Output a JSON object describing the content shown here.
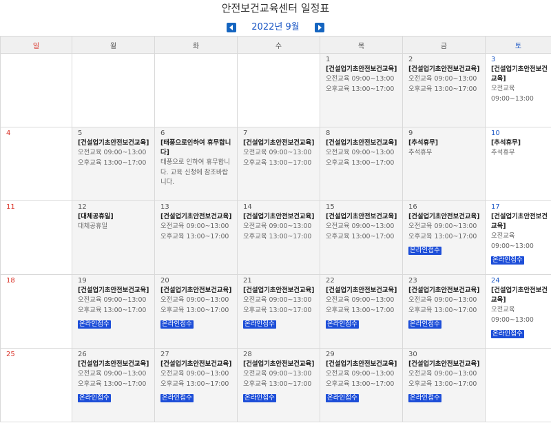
{
  "page": {
    "title": "안전보건교육센터 일정표",
    "month_label": "2022년 9월",
    "accent_color": "#1565c0",
    "sunday_color": "#d93025",
    "saturday_color": "#1a56c4"
  },
  "weekdays": [
    {
      "label": "일",
      "kind": "sun"
    },
    {
      "label": "월",
      "kind": ""
    },
    {
      "label": "화",
      "kind": ""
    },
    {
      "label": "수",
      "kind": ""
    },
    {
      "label": "목",
      "kind": ""
    },
    {
      "label": "금",
      "kind": ""
    },
    {
      "label": "토",
      "kind": "sat"
    }
  ],
  "weeks": [
    [
      null,
      null,
      null,
      null,
      {
        "day": "1",
        "title": "[건설업기초안전보건교육]",
        "lines": [
          "오전교육 09:00~13:00",
          "오후교육 13:00~17:00"
        ]
      },
      {
        "day": "2",
        "title": "[건설업기초안전보건교육]",
        "lines": [
          "오전교육 09:00~13:00",
          "오후교육 13:00~17:00"
        ]
      },
      {
        "day": "3",
        "title": "[건설업기초안전보건교육]",
        "lines": [
          "오전교육",
          "09:00~13:00"
        ]
      }
    ],
    [
      {
        "day": "4"
      },
      {
        "day": "5",
        "title": "[건설업기초안전보건교육]",
        "lines": [
          "오전교육 09:00~13:00",
          "오후교육 13:00~17:00"
        ]
      },
      {
        "day": "6",
        "title": "[태풍으로인하여 휴무합니다]",
        "lines": [
          "태풍으로 인하여 휴무합니다. 교육 신청에 참조바랍니다."
        ],
        "wrap": true
      },
      {
        "day": "7",
        "title": "[건설업기초안전보건교육]",
        "lines": [
          "오전교육 09:00~13:00",
          "오후교육 13:00~17:00"
        ]
      },
      {
        "day": "8",
        "title": "[건설업기초안전보건교육]",
        "lines": [
          "오전교육 09:00~13:00",
          "오후교육 13:00~17:00"
        ]
      },
      {
        "day": "9",
        "title": "[추석휴무]",
        "lines": [
          "추석휴무"
        ]
      },
      {
        "day": "10",
        "title": "[추석휴무]",
        "lines": [
          "추석휴무"
        ]
      }
    ],
    [
      {
        "day": "11"
      },
      {
        "day": "12",
        "title": "[대체공휴일]",
        "lines": [
          "대체공휴일"
        ]
      },
      {
        "day": "13",
        "title": "[건설업기초안전보건교육]",
        "lines": [
          "오전교육 09:00~13:00",
          "오후교육 13:00~17:00"
        ]
      },
      {
        "day": "14",
        "title": "[건설업기초안전보건교육]",
        "lines": [
          "오전교육 09:00~13:00",
          "오후교육 13:00~17:00"
        ]
      },
      {
        "day": "15",
        "title": "[건설업기초안전보건교육]",
        "lines": [
          "오전교육 09:00~13:00",
          "오후교육 13:00~17:00"
        ]
      },
      {
        "day": "16",
        "title": "[건설업기초안전보건교육]",
        "lines": [
          "오전교육 09:00~13:00",
          "오후교육 13:00~17:00"
        ],
        "badge": "온라인접수"
      },
      {
        "day": "17",
        "title": "[건설업기초안전보건교육]",
        "lines": [
          "오전교육",
          "09:00~13:00"
        ],
        "badge": "온라인접수"
      }
    ],
    [
      {
        "day": "18"
      },
      {
        "day": "19",
        "title": "[건설업기초안전보건교육]",
        "lines": [
          "오전교육 09:00~13:00",
          "오후교육 13:00~17:00"
        ],
        "badge": "온라인접수"
      },
      {
        "day": "20",
        "title": "[건설업기초안전보건교육]",
        "lines": [
          "오전교육 09:00~13:00",
          "오후교육 13:00~17:00"
        ],
        "badge": "온라인접수"
      },
      {
        "day": "21",
        "title": "[건설업기초안전보건교육]",
        "lines": [
          "오전교육 09:00~13:00",
          "오후교육 13:00~17:00"
        ],
        "badge": "온라인접수"
      },
      {
        "day": "22",
        "title": "[건설업기초안전보건교육]",
        "lines": [
          "오전교육 09:00~13:00",
          "오후교육 13:00~17:00"
        ],
        "badge": "온라인접수"
      },
      {
        "day": "23",
        "title": "[건설업기초안전보건교육]",
        "lines": [
          "오전교육 09:00~13:00",
          "오후교육 13:00~17:00"
        ],
        "badge": "온라인접수"
      },
      {
        "day": "24",
        "title": "[건설업기초안전보건교육]",
        "lines": [
          "오전교육",
          "09:00~13:00"
        ],
        "badge": "온라인접수"
      }
    ],
    [
      {
        "day": "25"
      },
      {
        "day": "26",
        "title": "[건설업기초안전보건교육]",
        "lines": [
          "오전교육 09:00~13:00",
          "오후교육 13:00~17:00"
        ],
        "badge": "온라인접수"
      },
      {
        "day": "27",
        "title": "[건설업기초안전보건교육]",
        "lines": [
          "오전교육 09:00~13:00",
          "오후교육 13:00~17:00"
        ],
        "badge": "온라인접수"
      },
      {
        "day": "28",
        "title": "[건설업기초안전보건교육]",
        "lines": [
          "오전교육 09:00~13:00",
          "오후교육 13:00~17:00"
        ],
        "badge": "온라인접수"
      },
      {
        "day": "29",
        "title": "[건설업기초안전보건교육]",
        "lines": [
          "오전교육 09:00~13:00",
          "오후교육 13:00~17:00"
        ],
        "badge": "온라인접수"
      },
      {
        "day": "30",
        "title": "[건설업기초안전보건교육]",
        "lines": [
          "오전교육 09:00~13:00",
          "오후교육 13:00~17:00"
        ],
        "badge": "온라인접수"
      },
      null
    ]
  ]
}
